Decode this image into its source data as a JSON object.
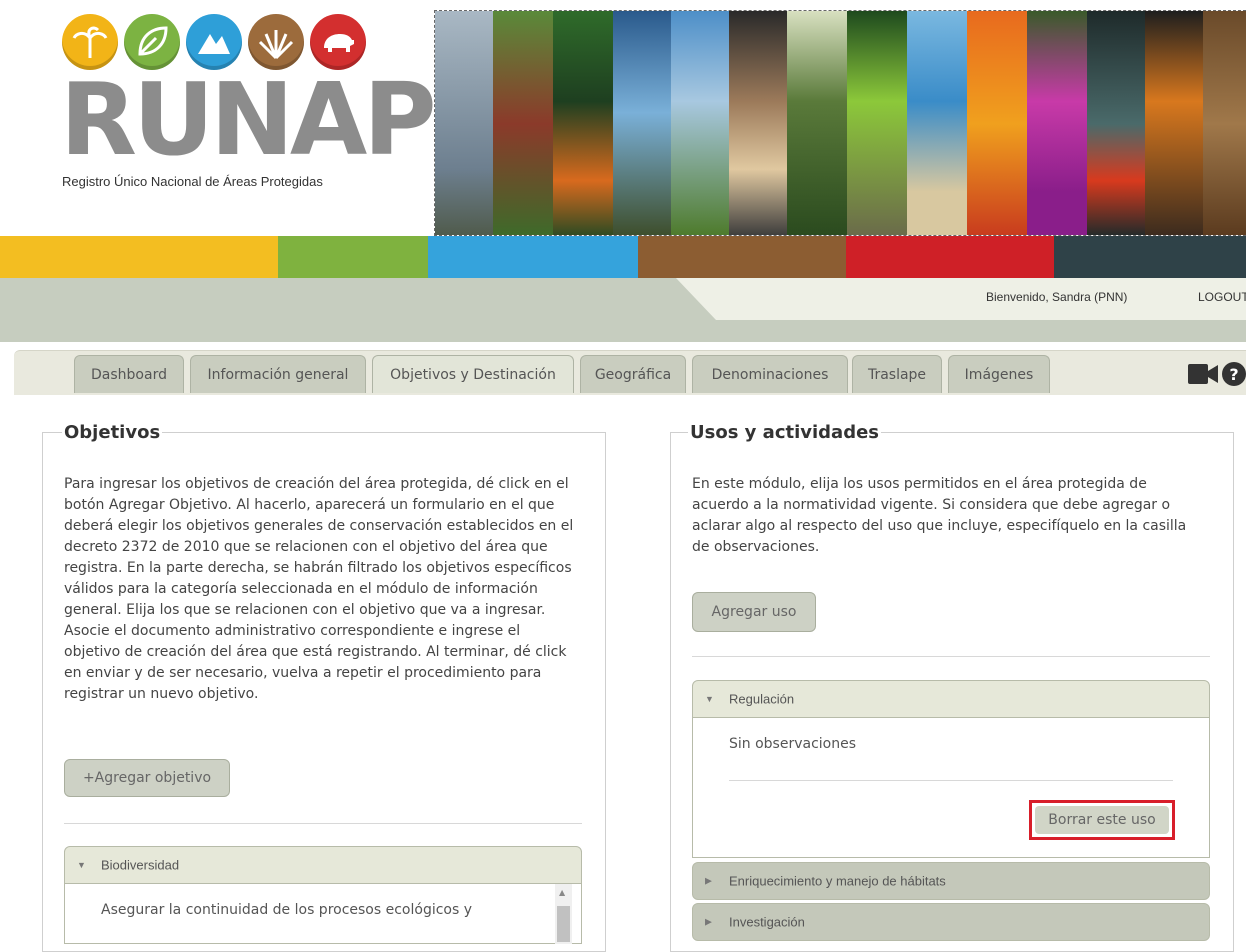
{
  "header": {
    "logo_word": "RUNAP",
    "logo_subtitle": "Registro Único Nacional de Áreas Protegidas",
    "logo_icons": [
      "palm-tree-icon",
      "leaf-icon",
      "mountain-icon",
      "grass-icon",
      "bear-icon"
    ],
    "logo_colors": [
      "#f2b417",
      "#7cb342",
      "#2e9fd8",
      "#9c6b3c",
      "#d32f2f"
    ]
  },
  "colorbar": [
    "#f3be21",
    "#7fb23f",
    "#35a3dc",
    "#8c5d32",
    "#cf2027",
    "#2f4248"
  ],
  "userbar": {
    "welcome": "Bienvenido, Sandra (PNN)",
    "logout": "LOGOUT"
  },
  "tabs": [
    {
      "label": "Dashboard"
    },
    {
      "label": "Información general"
    },
    {
      "label": "Objetivos y Destinación"
    },
    {
      "label": "Geográfica"
    },
    {
      "label": "Denominaciones"
    },
    {
      "label": "Traslape"
    },
    {
      "label": "Imágenes"
    }
  ],
  "toolbar": {
    "video_icon": "video-camera-icon",
    "help_icon": "help-icon"
  },
  "objetivos": {
    "title": "Objetivos",
    "description_lines": [
      "Para ingresar los objetivos de creación del área protegida, dé click en el",
      "botón Agregar Objetivo. Al hacerlo, aparecerá un formulario en el que",
      "deberá elegir los objetivos generales de conservación establecidos en el",
      "decreto 2372 de 2010 que se relacionen con el objetivo del área que",
      "registra. En la parte derecha, se habrán filtrado los objetivos específicos",
      "válidos para la categoría seleccionada en el módulo de información",
      "general. Elija los que se relacionen con el objetivo que va a ingresar.",
      "Asocie el documento administrativo correspondiente e ingrese el",
      "objetivo de creación del área que está registrando. Al terminar, dé click",
      "en enviar y de ser necesario, vuelva a repetir el procedimiento para",
      "registrar un nuevo objetivo."
    ],
    "add_button": "+Agregar objetivo",
    "accordion": {
      "label": "Biodiversidad",
      "text_line": "Asegurar la continuidad de los procesos ecológicos y"
    }
  },
  "usos": {
    "title": "Usos y actividades",
    "description_lines": [
      "En este módulo, elija los usos permitidos en el área protegida de",
      "acuerdo a la normatividad vigente. Si considera que debe agregar o",
      "aclarar algo al respecto del uso que incluye, especifíquelo en la casilla",
      "de observaciones."
    ],
    "add_button": "Agregar uso",
    "accordion": [
      {
        "label": "Regulación",
        "observations": "Sin observaciones",
        "delete_button": "Borrar este uso"
      },
      {
        "label": "Enriquecimiento y manejo de hábitats"
      },
      {
        "label": "Investigación"
      }
    ]
  }
}
